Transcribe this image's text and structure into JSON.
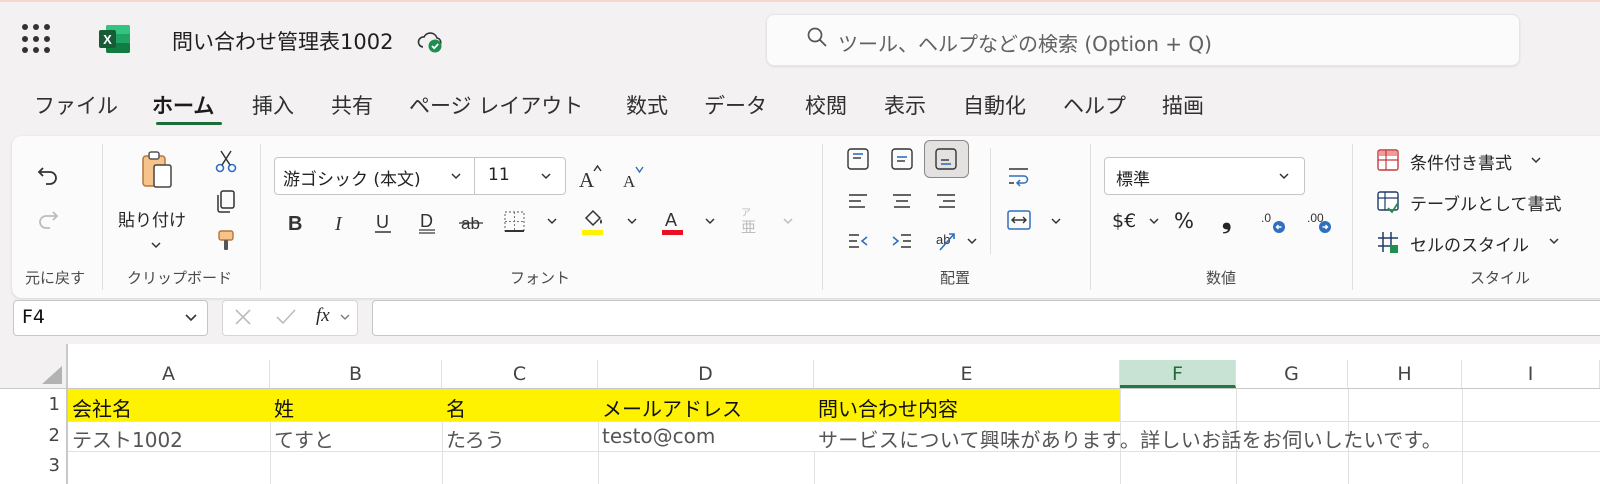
{
  "app": {
    "document_title": "問い合わせ管理表1002",
    "search_placeholder": "ツール、ヘルプなどの検索 (Option + Q)"
  },
  "tabs": [
    {
      "label": "ファイル"
    },
    {
      "label": "ホーム",
      "active": true
    },
    {
      "label": "挿入"
    },
    {
      "label": "共有"
    },
    {
      "label": "ページ レイアウト"
    },
    {
      "label": "数式"
    },
    {
      "label": "データ"
    },
    {
      "label": "校閲"
    },
    {
      "label": "表示"
    },
    {
      "label": "自動化"
    },
    {
      "label": "ヘルプ"
    },
    {
      "label": "描画"
    }
  ],
  "ribbon": {
    "undo_group_label": "元に戻す",
    "clipboard": {
      "paste_label": "貼り付け",
      "group_label": "クリップボード"
    },
    "font": {
      "name": "游ゴシック (本文)",
      "size": "11",
      "group_label": "フォント"
    },
    "alignment": {
      "group_label": "配置"
    },
    "number": {
      "format": "標準",
      "currency_symbol": "$€",
      "percent_symbol": "%",
      "comma_symbol": "❟",
      "group_label": "数値"
    },
    "styles": {
      "conditional": "条件付き書式",
      "as_table": "テーブルとして書式",
      "cell_styles": "セルのスタイル",
      "group_label": "スタイル"
    }
  },
  "formula_bar": {
    "name_box": "F4",
    "fx_label": "fx",
    "formula": ""
  },
  "sheet": {
    "columns": [
      "A",
      "B",
      "C",
      "D",
      "E",
      "F",
      "G",
      "H",
      "I"
    ],
    "selected_column": "F",
    "row_numbers": [
      "1",
      "2",
      "3"
    ],
    "rows": [
      [
        "会社名",
        "姓",
        "名",
        "メールアドレス",
        "問い合わせ内容"
      ],
      [
        "テスト1002",
        "てすと",
        "たろう",
        "testo@com",
        "サービスについて興味があります。詳しいお話をお伺いしたいです。"
      ]
    ]
  },
  "colors": {
    "accent": "#1b6e3a",
    "header_fill": "#fff200",
    "selected_col": "#c8e3d4"
  }
}
